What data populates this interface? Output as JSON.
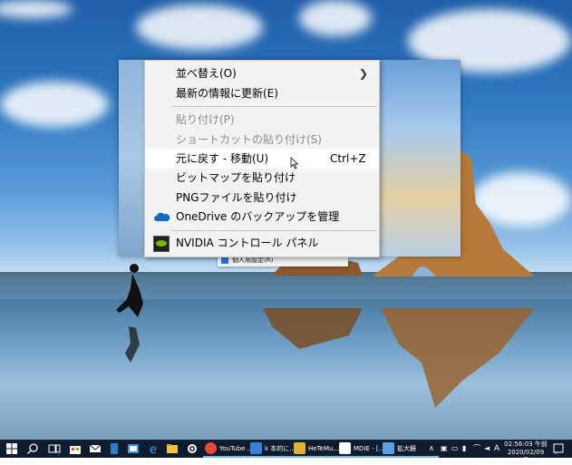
{
  "context_menu": {
    "items": [
      {
        "label": "並べ替え(O)",
        "state": "normal",
        "submenu": true
      },
      {
        "label": "最新の情報に更新(E)",
        "state": "normal"
      },
      {
        "label": "貼り付け(P)",
        "state": "disabled"
      },
      {
        "label": "ショートカットの貼り付け(S)",
        "state": "disabled"
      },
      {
        "label": "元に戻す - 移動(U)",
        "state": "hover",
        "shortcut": "Ctrl+Z"
      },
      {
        "label": "ビットマップを貼り付け",
        "state": "normal"
      },
      {
        "label": "PNGファイルを貼り付け",
        "state": "normal"
      },
      {
        "label": "OneDrive のバックアップを管理",
        "state": "normal",
        "icon": "onedrive-icon"
      },
      {
        "label": "NVIDIA コントロール パネル",
        "state": "normal",
        "icon": "nvidia-icon"
      }
    ]
  },
  "background_window": {
    "item_label": "個人用設定(R)"
  },
  "taskbar": {
    "buttons": [
      {
        "label": "YouTube ...",
        "icon": "chrome-icon",
        "color": "#e8453c"
      },
      {
        "label": "k 本的に...",
        "icon": "app-icon",
        "color": "#3b7dd8"
      },
      {
        "label": "HeTeMu...",
        "icon": "hetemu-icon",
        "color": "#e0b030"
      },
      {
        "label": "MDIE - [...",
        "icon": "mdie-icon",
        "color": "#ffffff"
      },
      {
        "label": "拡大鏡",
        "icon": "magnifier-icon",
        "color": "#5aa0e0"
      }
    ],
    "ime_indicator": "A",
    "clock_time": "02:56:03 午前",
    "clock_date": "2020/02/09 日"
  },
  "colors": {
    "taskbar": "#0f1c2d",
    "menu_bg": "#f2f2f2",
    "hover_bg": "#ffffff",
    "disabled_text": "#8c8c8c"
  }
}
